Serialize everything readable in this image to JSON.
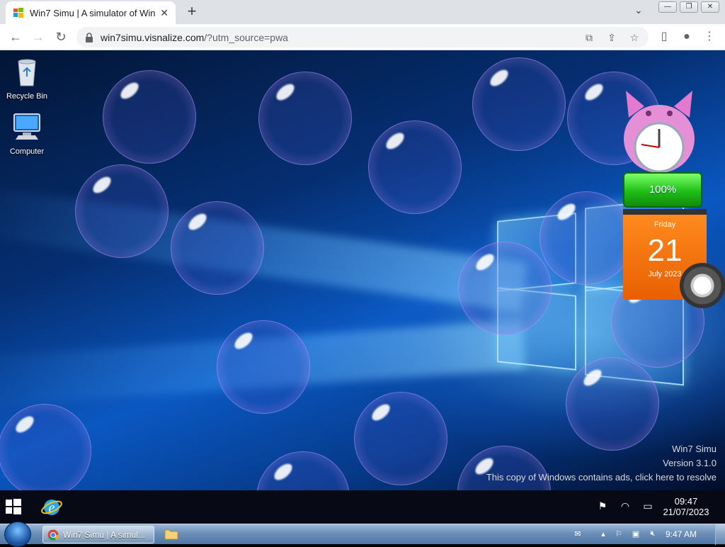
{
  "browser": {
    "tab_title": "Win7 Simu | A simulator of Wind",
    "url_host": "win7simu.visnalize.com",
    "url_rest": "/?utm_source=pwa",
    "new_tab_label": "+",
    "close_tab_label": "✕",
    "window_buttons": [
      "—",
      "❐",
      "✕"
    ]
  },
  "desktop": {
    "icons": [
      {
        "label": "Recycle Bin",
        "icon": "recycle-bin-icon"
      },
      {
        "label": "Computer",
        "icon": "computer-icon"
      }
    ],
    "gadgets": {
      "battery": "100%",
      "calendar_day": "Friday",
      "calendar_date": "21",
      "calendar_month_year": "July 2023"
    },
    "watermark": {
      "line1": "Win7 Simu",
      "line2": "Version 3.1.0",
      "line3": "This copy of Windows contains ads, click here to resolve"
    }
  },
  "inner_taskbar": {
    "time": "09:47",
    "date": "21/07/2023",
    "tray_icons": [
      "flag-icon",
      "wifi-icon",
      "battery-icon"
    ]
  },
  "win7_taskbar": {
    "task_label": "Win7 Simu | A simul...",
    "time": "9:47 AM",
    "tray_icons": [
      "action-center-icon",
      "show-hidden-icon",
      "network-error-icon",
      "display-icon",
      "volume-muted-icon"
    ]
  },
  "colors": {
    "chrome_tab_bg": "#dee1e6",
    "desktop_blue": "#0a58c2",
    "calendar_orange": "#e85f00",
    "battery_green": "#1fbf16"
  }
}
